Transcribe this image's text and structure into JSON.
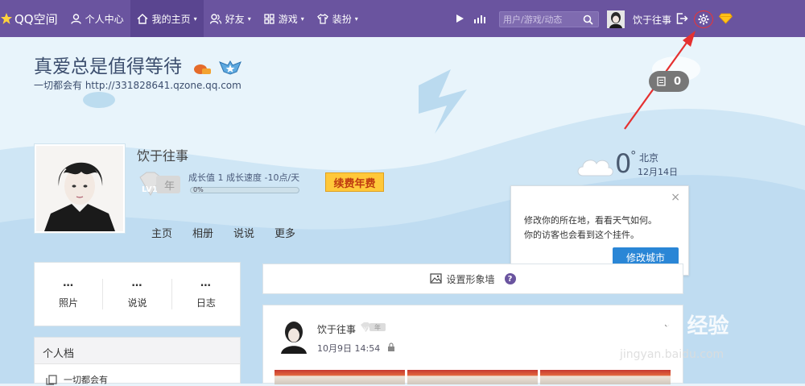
{
  "topnav": {
    "logo": "QQ空间",
    "items": [
      {
        "label": "个人中心",
        "icon": "person-icon"
      },
      {
        "label": "我的主页",
        "icon": "home-icon",
        "caret": "▾"
      },
      {
        "label": "好友",
        "icon": "friends-icon",
        "caret": "▾"
      },
      {
        "label": "游戏",
        "icon": "grid-icon",
        "caret": "▾"
      },
      {
        "label": "装扮",
        "icon": "shirt-icon",
        "caret": "▾"
      }
    ],
    "search_placeholder": "用户/游戏/动态",
    "username": "饮于往事"
  },
  "header": {
    "title": "真爱总是值得等待",
    "subtitle": "一切都会有 http://331828641.qzone.qq.com",
    "visit_count": "0"
  },
  "profile": {
    "name": "饮于往事",
    "level_badge": "LV1",
    "level_year": "年",
    "growth_text": "成长值 1   成长速度 -10点/天",
    "progress_label": "0%",
    "progress": 0,
    "renew_label": "续费年费",
    "tabs": [
      "主页",
      "相册",
      "说说",
      "更多"
    ]
  },
  "weather": {
    "temp": "0",
    "degree": "°",
    "city": "北京",
    "date": "12月14日",
    "tip_line1": "修改你的所在地，看看天气如何。",
    "tip_line2": "你的访客也会看到这个挂件。",
    "tip_button": "修改城市",
    "tip_close": "×"
  },
  "stats": [
    {
      "num": "…",
      "label": "照片"
    },
    {
      "num": "…",
      "label": "说说"
    },
    {
      "num": "…",
      "label": "日志"
    }
  ],
  "profile_panel": {
    "header": "个人档",
    "row": "一切都会有"
  },
  "wall": {
    "label": "设置形象墙",
    "help": "?"
  },
  "post": {
    "name": "饮于往事",
    "time": "10月9日 14:54",
    "level": "LV1",
    "level_year": "年"
  },
  "watermark": {
    "main": "Bai du 经验",
    "sub": "jingyan.baidu.com"
  },
  "colors": {
    "nav_bg": "#6a549f",
    "accent_blue": "#2a86d6",
    "renew_bg": "#ffc83a",
    "arrow": "#e53030"
  }
}
